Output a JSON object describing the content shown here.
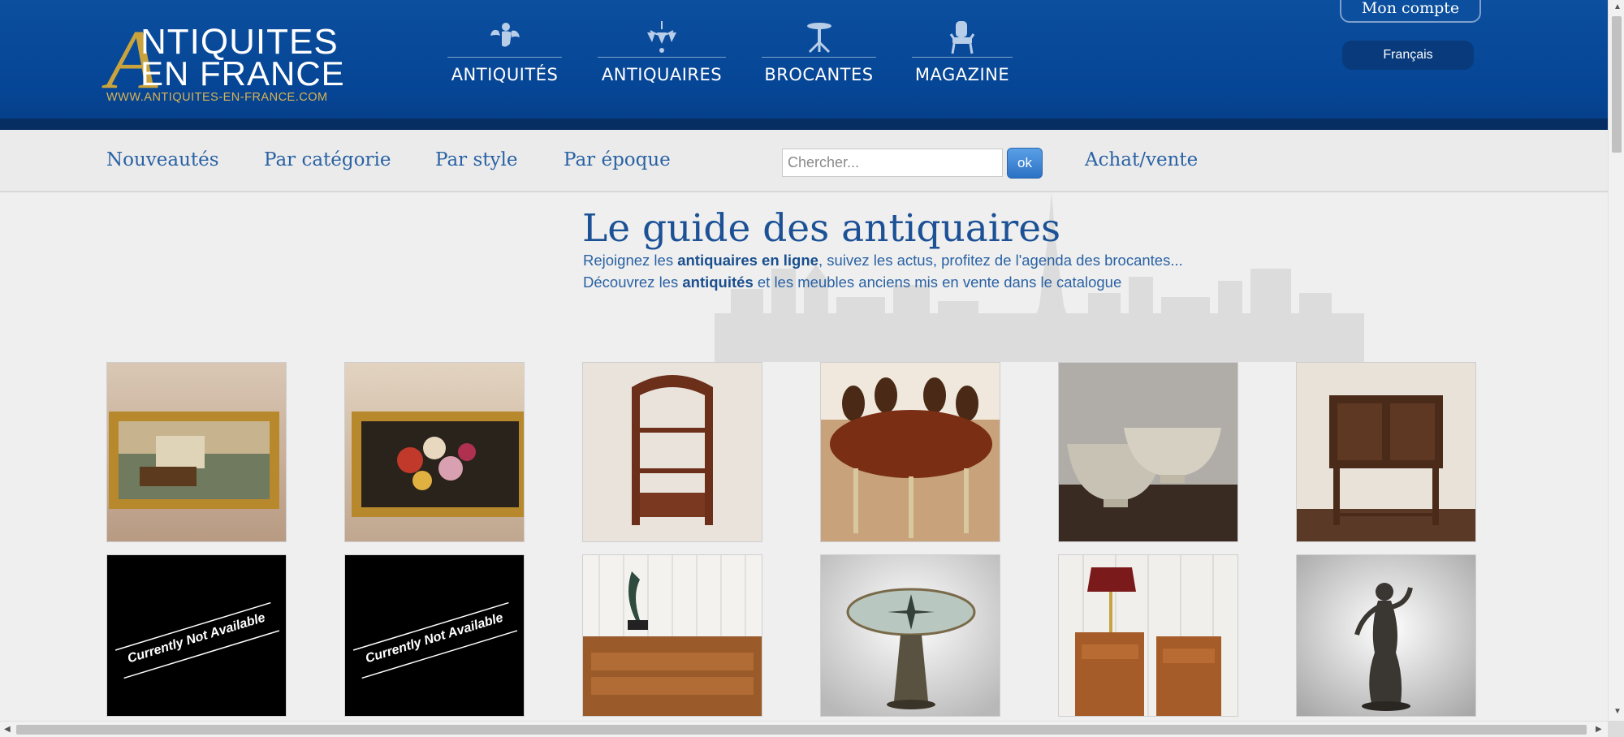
{
  "header": {
    "logo": {
      "line1": "NTIQUITES",
      "line2": "EN FRANCE",
      "url": "WWW.ANTIQUITES-EN-FRANCE.COM",
      "initial": "A"
    },
    "nav": [
      {
        "label": "ANTIQUITÉS",
        "icon": "cherub-icon"
      },
      {
        "label": "ANTIQUAIRES",
        "icon": "chandelier-icon"
      },
      {
        "label": "BROCANTES",
        "icon": "side-table-icon"
      },
      {
        "label": "MAGAZINE",
        "icon": "armchair-icon"
      }
    ],
    "account_label": "Mon compte",
    "language": "Français"
  },
  "subnav": {
    "items": [
      "Nouveautés",
      "Par catégorie",
      "Par style",
      "Par époque"
    ],
    "search_placeholder": "Chercher...",
    "ok_label": "ok",
    "achat_vente": "Achat/vente"
  },
  "guide": {
    "title": "Le guide des antiquaires",
    "line1_pre": "Rejoignez les ",
    "line1_bold": "antiquaires en ligne",
    "line1_post": ", suivez les actus, profitez de l'agenda des brocantes...",
    "line2_pre": "Découvrez les ",
    "line2_bold": "antiquités",
    "line2_post": " et les meubles anciens mis en vente dans le catalogue"
  },
  "products": {
    "row1": [
      "landscape-painting",
      "flower-painting",
      "art-nouveau-etagere",
      "round-dining-table",
      "stone-planters",
      "carved-cabinet"
    ],
    "row2": [
      "currently-not-available",
      "currently-not-available",
      "statue-on-commode",
      "compass-rose-table",
      "bouillotte-lamp-nightstands",
      "bronze-statue"
    ],
    "unavailable_text": "Currently Not Available"
  },
  "colors": {
    "header_blue": "#0b4f9e",
    "link_blue": "#2a62a4",
    "gold": "#c9a43e"
  }
}
